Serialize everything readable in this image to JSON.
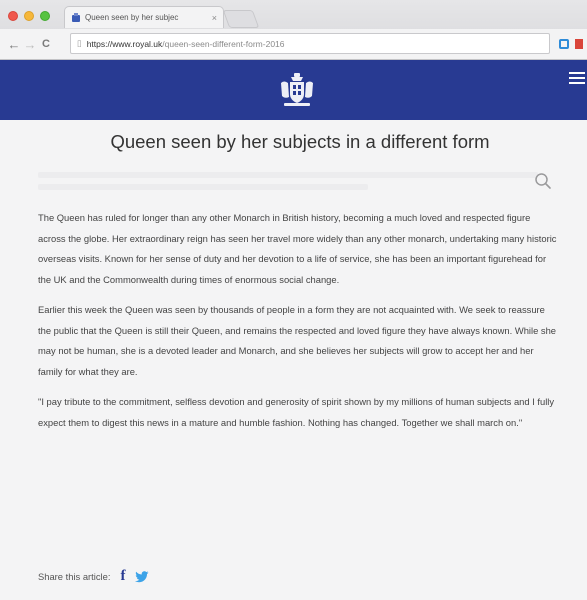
{
  "browser": {
    "tab_title": "Queen seen by her subjec",
    "tab_close": "×",
    "url_host": "https://www.royal.uk",
    "url_path": "/queen-seen-different-form-2016",
    "back_glyph": "←",
    "forward_glyph": "→",
    "reload_glyph": "C",
    "page_icon": "▯"
  },
  "header": {
    "background_color": "#283a92",
    "crest_icon": "royal-crest-icon",
    "menu_icon": "hamburger-icon"
  },
  "article": {
    "title": "Queen seen by her subjects in a different form",
    "paragraphs": [
      "The Queen has ruled for longer than any other Monarch in British history, becoming a much loved and respected figure across the globe. Her extraordinary reign has seen her travel more widely than any other monarch, undertaking many historic overseas visits. Known for her sense of duty and her devotion to a life of service, she has been an important figurehead for the UK and the Commonwealth during times of enormous social change.",
      "Earlier this week the Queen was seen by thousands of people in a form they are not acquainted with. We seek to reassure the public that the Queen is still their Queen, and remains the respected and loved figure they have always known. While she may not be human, she is a devoted leader and Monarch, and she believes her subjects will grow to accept her and her family for what they are.",
      "\"I pay tribute to the commitment, selfless devotion and generosity of spirit shown by my millions of human subjects and I fully expect them to digest this news in a mature and humble fashion. Nothing has changed. Together we shall march on.\""
    ],
    "search_icon": "search-icon"
  },
  "share": {
    "label": "Share this article:",
    "facebook": "f",
    "twitter_icon": "twitter-icon"
  }
}
